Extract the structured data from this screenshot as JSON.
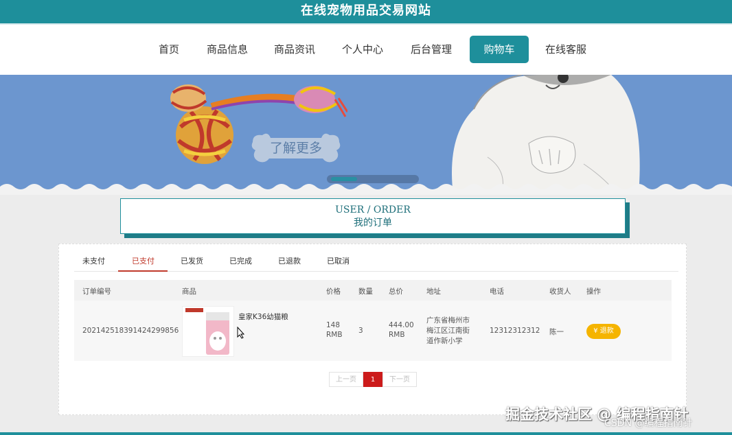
{
  "site": {
    "title": "在线宠物用品交易网站"
  },
  "nav": {
    "items": [
      "首页",
      "商品信息",
      "商品资讯",
      "个人中心",
      "后台管理",
      "购物车",
      "在线客服"
    ],
    "active": "购物车"
  },
  "banner": {
    "button_label": "了解更多"
  },
  "order_header": {
    "en": "USER / ORDER",
    "cn": "我的订单"
  },
  "tabs": [
    "未支付",
    "已支付",
    "已发货",
    "已完成",
    "已退款",
    "已取消"
  ],
  "active_tab": "已支付",
  "table": {
    "headers": [
      "订单编号",
      "商品",
      "价格",
      "数量",
      "总价",
      "地址",
      "电话",
      "收货人",
      "操作"
    ],
    "rows": [
      {
        "order_no": "20214251839142429985​6",
        "product": "皇家K36幼猫粮",
        "price": "148",
        "price_unit": "RMB",
        "qty": "3",
        "total": "444.00",
        "total_unit": "RMB",
        "address_l1": "广东省梅州市",
        "address_l2": "梅江区江南街",
        "address_l3": "道作新小学",
        "phone": "12312312312",
        "receiver": "陈一",
        "action": "退款"
      }
    ]
  },
  "pager": {
    "prev": "上一页",
    "current": "1",
    "next": "下一页"
  },
  "watermark": {
    "line1": "掘金技术社区 @ 编程指南针",
    "line2": "CSDN @编程指南针"
  },
  "colors": {
    "primary": "#1e8f9b",
    "banner": "#6c96cf",
    "refund": "#f5b400",
    "page_active": "#cc1b1b",
    "tab_active": "#c0392b"
  }
}
